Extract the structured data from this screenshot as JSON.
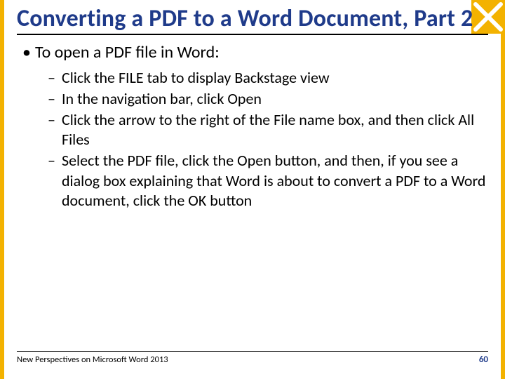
{
  "title": "Converting a PDF to a Word Document, Part 2",
  "bullet1": "To open a PDF file in Word:",
  "sub1": "Click the FILE tab to display Backstage view",
  "sub2": "In the navigation bar, click Open",
  "sub3": "Click the arrow to the right of the File name box, and then click All Files",
  "sub4": "Select the PDF file, click the Open button, and then, if you see a dialog box explaining that Word is about to convert a PDF to a Word document, click the OK button",
  "footer_text": "New Perspectives on Microsoft Word 2013",
  "page_number": "60",
  "colors": {
    "accent_blue": "#1f3b8a",
    "accent_gold": "#f3b200"
  }
}
